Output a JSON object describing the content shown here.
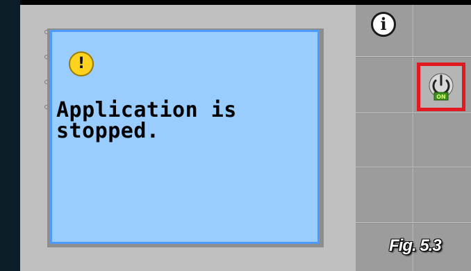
{
  "dialog": {
    "message": "Application is\nstopped."
  },
  "softkeys": {
    "info": {
      "icon": "info-icon",
      "label": "i"
    },
    "power": {
      "icon": "power-on-icon",
      "badge": "ON",
      "highlight_color": "#e11a22"
    }
  },
  "figure_label": "Fig. 5.3",
  "colors": {
    "dialog_bg": "#99ccff",
    "dialog_border": "#4d9bff",
    "warning": "#ffd21e"
  }
}
